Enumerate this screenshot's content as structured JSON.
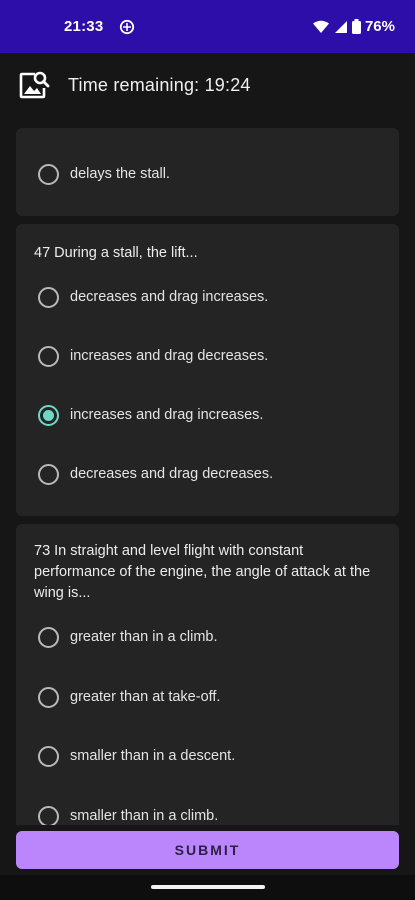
{
  "status_bar": {
    "time": "21:33",
    "battery": "76%",
    "icons": [
      "sync-icon",
      "wifi-icon",
      "signal-icon",
      "battery-icon"
    ]
  },
  "header": {
    "icon": "image-search-icon",
    "timer": "Time remaining: 19:24"
  },
  "questions": [
    {
      "text": "",
      "options": [
        {
          "label": "delays the stall.",
          "selected": false
        }
      ]
    },
    {
      "text": "47 During a stall, the lift...",
      "options": [
        {
          "label": "decreases and drag increases.",
          "selected": false
        },
        {
          "label": "increases and drag decreases.",
          "selected": false
        },
        {
          "label": "increases and drag increases.",
          "selected": true
        },
        {
          "label": "decreases and drag decreases.",
          "selected": false
        }
      ]
    },
    {
      "text": "73 In straight and level flight with constant performance of the engine, the angle of attack at the wing is...",
      "options": [
        {
          "label": "greater than in a climb.",
          "selected": false
        },
        {
          "label": "greater than at take-off.",
          "selected": false
        },
        {
          "label": "smaller than in a descent.",
          "selected": false
        },
        {
          "label": "smaller than in a climb.",
          "selected": false
        }
      ]
    }
  ],
  "submit": {
    "label": "SUBMIT"
  },
  "colors": {
    "status_bar": "#2e0ea9",
    "accent_radio": "#70d7c7",
    "submit_button": "#bb86fc",
    "card": "#242424",
    "background": "#161616"
  }
}
